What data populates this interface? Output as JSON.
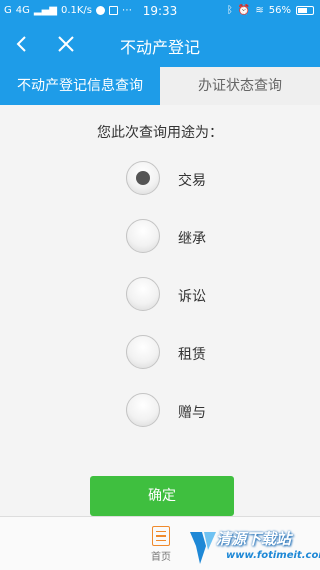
{
  "status_bar": {
    "left_text": "G",
    "network": "4G",
    "speed": "0.1K/s",
    "time": "19:33",
    "battery": "56%"
  },
  "navbar": {
    "title": "不动产登记",
    "back_icon": "chevron-left-icon",
    "close_icon": "close-icon"
  },
  "tabs": [
    {
      "label": "不动产登记信息查询",
      "active": true
    },
    {
      "label": "办证状态查询",
      "active": false
    }
  ],
  "question": "您此次查询用途为：",
  "options": [
    {
      "label": "交易",
      "selected": true
    },
    {
      "label": "继承",
      "selected": false
    },
    {
      "label": "诉讼",
      "selected": false
    },
    {
      "label": "租赁",
      "selected": false
    },
    {
      "label": "赠与",
      "selected": false
    }
  ],
  "confirm_label": "确定",
  "bottom_nav": {
    "home_label": "首页",
    "home_icon": "document-list-icon"
  },
  "watermark": {
    "title": "清源下载站",
    "url": "www.fotimeit.com"
  },
  "colors": {
    "primary": "#1e9ce8",
    "confirm": "#3fbf3f",
    "home_accent": "#f08a2c"
  }
}
